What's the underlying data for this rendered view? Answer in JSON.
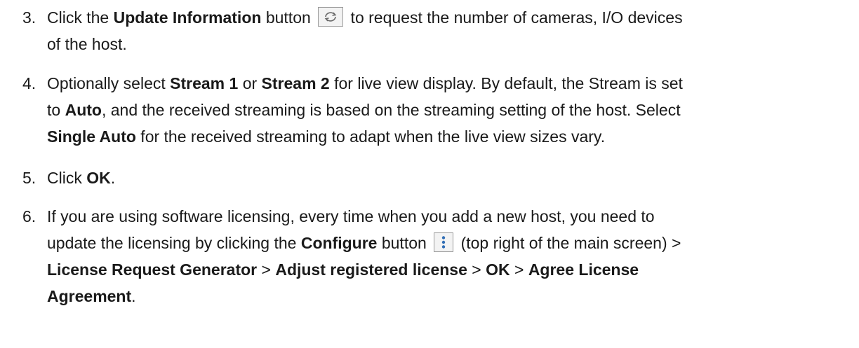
{
  "steps": [
    {
      "number": "3.",
      "seg1": "Click the ",
      "b1": "Update Information",
      "seg2": " button ",
      "icon": "refresh-icon",
      "seg3": " to request the number of cameras, I/O devices",
      "line2": "of the host."
    },
    {
      "number": "4.",
      "l1a": "Optionally select ",
      "l1b": "Stream 1",
      "l1c": " or ",
      "l1d": "Stream 2",
      "l1e": " for live view display. By default, the Stream is set",
      "l2a": "to ",
      "l2b": "Auto",
      "l2c": ", and the received streaming is based on the streaming setting of the host. Select",
      "l3a": "Single Auto",
      "l3b": " for the received streaming to adapt when the live view sizes vary."
    },
    {
      "number": "5.",
      "a": "Click ",
      "b": "OK",
      "c": "."
    },
    {
      "number": "6.",
      "l1": "If you are using software licensing, every time when you add a new host, you need to",
      "l2a": "update the licensing by clicking the ",
      "l2b": "Configure",
      "l2c": " button ",
      "icon": "vertical-dots-icon",
      "l2d": " (top right of the main screen) >",
      "l3a": "License Request Generator",
      "l3b": " > ",
      "l3c": "Adjust registered license",
      "l3d": " > ",
      "l3e": "OK",
      "l3f": " > ",
      "l3g": "Agree License",
      "l4a": "Agreement",
      "l4b": "."
    }
  ]
}
